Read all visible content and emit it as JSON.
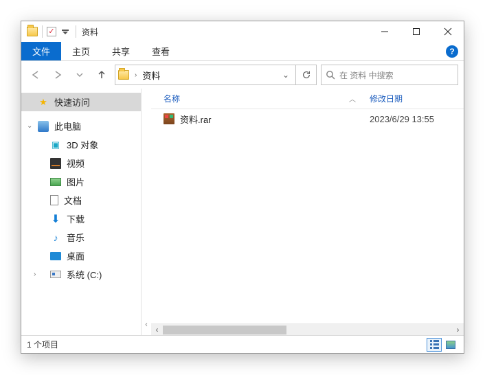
{
  "window": {
    "title": "资料"
  },
  "ribbon": {
    "file": "文件",
    "home": "主页",
    "share": "共享",
    "view": "查看"
  },
  "address": {
    "segments": [
      "资料"
    ]
  },
  "search": {
    "placeholder": "在 资料 中搜索"
  },
  "sidebar": {
    "quick_access": "快速访问",
    "this_pc": "此电脑",
    "items": [
      {
        "label": "3D 对象"
      },
      {
        "label": "视频"
      },
      {
        "label": "图片"
      },
      {
        "label": "文档"
      },
      {
        "label": "下载"
      },
      {
        "label": "音乐"
      },
      {
        "label": "桌面"
      },
      {
        "label": "系统 (C:)"
      }
    ]
  },
  "columns": {
    "name": "名称",
    "modified": "修改日期"
  },
  "files": [
    {
      "name": "资料.rar",
      "modified": "2023/6/29 13:55"
    }
  ],
  "status": {
    "count": "1 个项目"
  }
}
